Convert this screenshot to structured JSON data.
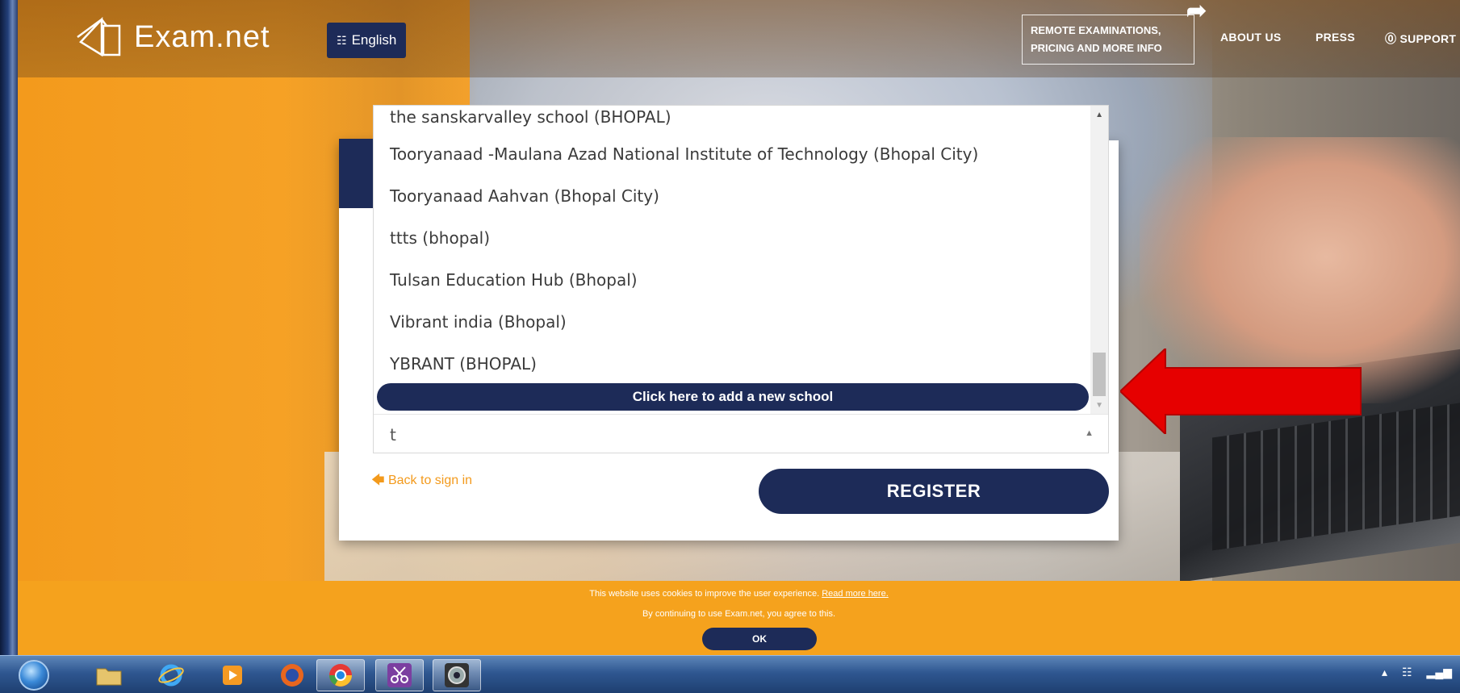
{
  "header": {
    "logo_text": "Exam.net",
    "language_button": "English",
    "remote_info_line1": "REMOTE EXAMINATIONS,",
    "remote_info_line2": "PRICING AND MORE INFO",
    "nav": {
      "about": "ABOUT US",
      "press": "PRESS",
      "support": "⓪ SUPPORT"
    }
  },
  "school_dropdown": {
    "items": [
      "the sanskarvalley school (BHOPAL)",
      "Tooryanaad -Maulana Azad National Institute of Technology (Bhopal City)",
      "Tooryanaad Aahvan (Bhopal City)",
      "ttts (bhopal)",
      "Tulsan Education Hub (Bhopal)",
      "Vibrant india (Bhopal)",
      "YBRANT (BHOPAL)"
    ],
    "add_new_school_label": "Click here to add a new school",
    "search_value": "t"
  },
  "form": {
    "back_link": "Back to sign in",
    "register_button": "REGISTER"
  },
  "cookie_notice": {
    "line1_text": "This website uses cookies to improve the user experience.",
    "line1_link": "Read more here.",
    "line2_text": "By continuing to use Exam.net, you agree to this.",
    "ok_button": "OK"
  },
  "colors": {
    "brand_navy": "#1d2b58",
    "brand_orange": "#f39a1c",
    "callout_red": "#e60000"
  }
}
